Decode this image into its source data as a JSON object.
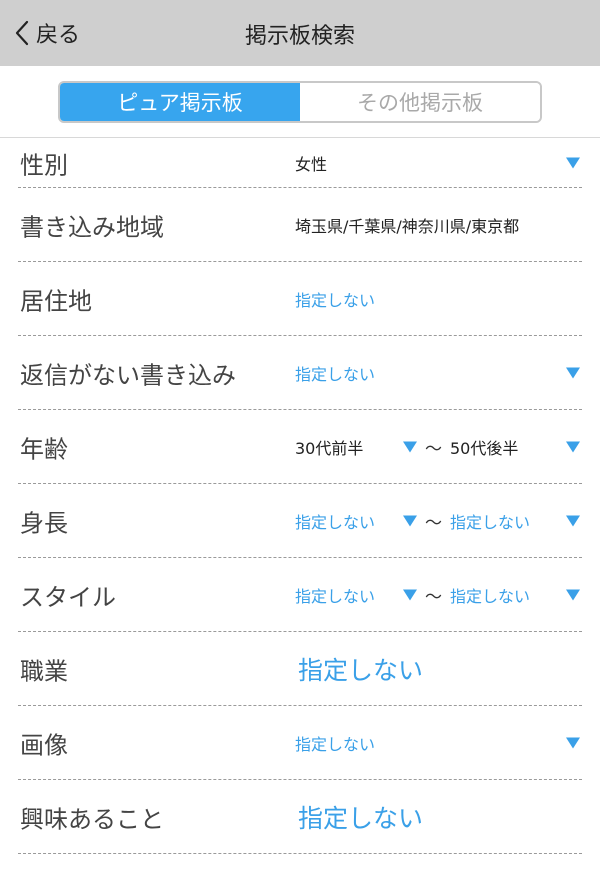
{
  "navbar": {
    "back_label": "戻る",
    "title": "掲示板検索"
  },
  "segments": [
    {
      "label": "ピュア掲示板",
      "active": true
    },
    {
      "label": "その他掲示板",
      "active": false
    }
  ],
  "rows": {
    "gender": {
      "label": "性別",
      "value": "女性"
    },
    "post_area": {
      "label": "書き込み地域",
      "value": "埼玉県/千葉県/神奈川県/東京都"
    },
    "residence": {
      "label": "居住地",
      "value": "指定しない"
    },
    "no_reply": {
      "label": "返信がない書き込み",
      "value": "指定しない"
    },
    "age": {
      "label": "年齢",
      "from": "30代前半",
      "separator": "〜",
      "to": "50代後半"
    },
    "height": {
      "label": "身長",
      "from": "指定しない",
      "separator": "〜",
      "to": "指定しない"
    },
    "style": {
      "label": "スタイル",
      "from": "指定しない",
      "separator": "〜",
      "to": "指定しない"
    },
    "occupation": {
      "label": "職業",
      "value": "指定しない"
    },
    "image": {
      "label": "画像",
      "value": "指定しない"
    },
    "interests": {
      "label": "興味あること",
      "value": "指定しない"
    }
  },
  "colors": {
    "accent": "#37a5ee",
    "navbar_bg": "#cfcfcf"
  },
  "icons": {
    "back": "chevron-left-icon",
    "dropdown": "triangle-down-icon"
  }
}
